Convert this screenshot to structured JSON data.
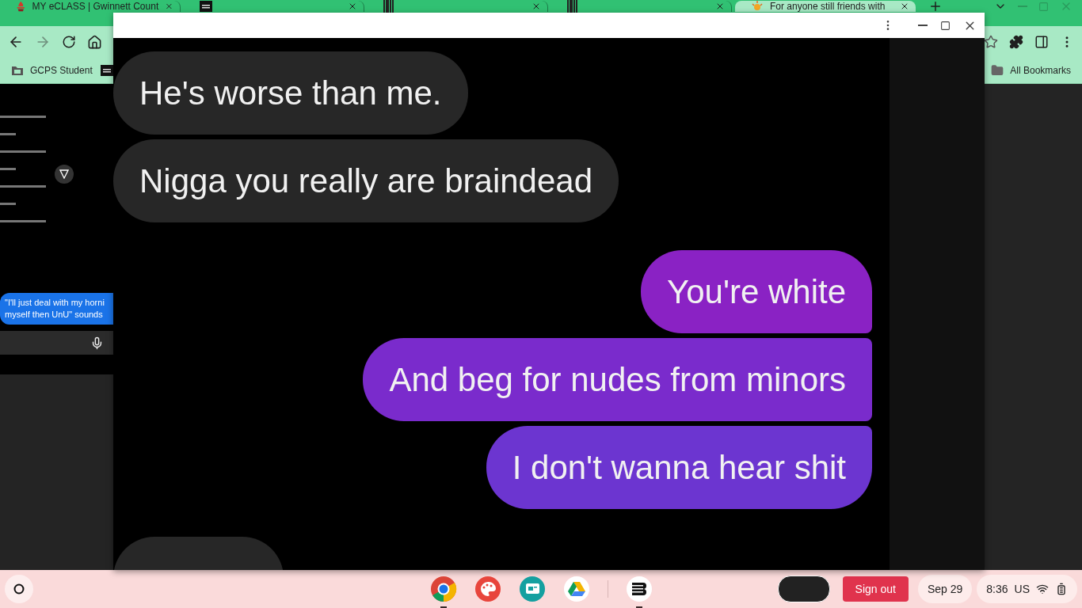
{
  "browser": {
    "tabs": [
      {
        "title": "MY eCLASS | Gwinnett Count",
        "selected": false,
        "kind": "flame"
      },
      {
        "selected": false,
        "kind": "square"
      },
      {
        "selected": false,
        "kind": "barcode"
      },
      {
        "selected": false,
        "kind": "barcode"
      },
      {
        "title": "For anyone still friends with",
        "selected": true,
        "kind": "sun"
      }
    ],
    "forward_disabled": true,
    "bookmarks": [
      {
        "label": "GCPS Student",
        "kind": "folder"
      },
      {
        "kind": "square"
      }
    ],
    "all_bookmarks": "All Bookmarks"
  },
  "background_page": {
    "message_preview": [
      "\"I'll just deal with my horni",
      "myself then UnU\" sounds"
    ]
  },
  "viewer": {
    "messages": [
      {
        "kind": "received",
        "text": "He's worse than me."
      },
      {
        "kind": "received",
        "text": "Nigga you really are braindead"
      },
      {
        "kind": "sent",
        "text": "You're white",
        "color": "#8a22c4"
      },
      {
        "kind": "sent",
        "text": "And beg for nudes from minors",
        "color": "#7a2bcc"
      },
      {
        "kind": "sent",
        "text": "I don't wanna hear shit",
        "color": "#6c35d0"
      },
      {
        "kind": "received"
      }
    ]
  },
  "shelf": {
    "apps": [
      {
        "kind": "chrome",
        "active": true
      },
      {
        "kind": "palette",
        "active": false
      },
      {
        "kind": "slides",
        "active": false
      },
      {
        "kind": "drive",
        "active": false
      },
      {
        "kind": "stripes",
        "active": true
      }
    ],
    "sign_out": "Sign out",
    "date": "Sep 29",
    "time": "8:36",
    "ime": "US"
  }
}
